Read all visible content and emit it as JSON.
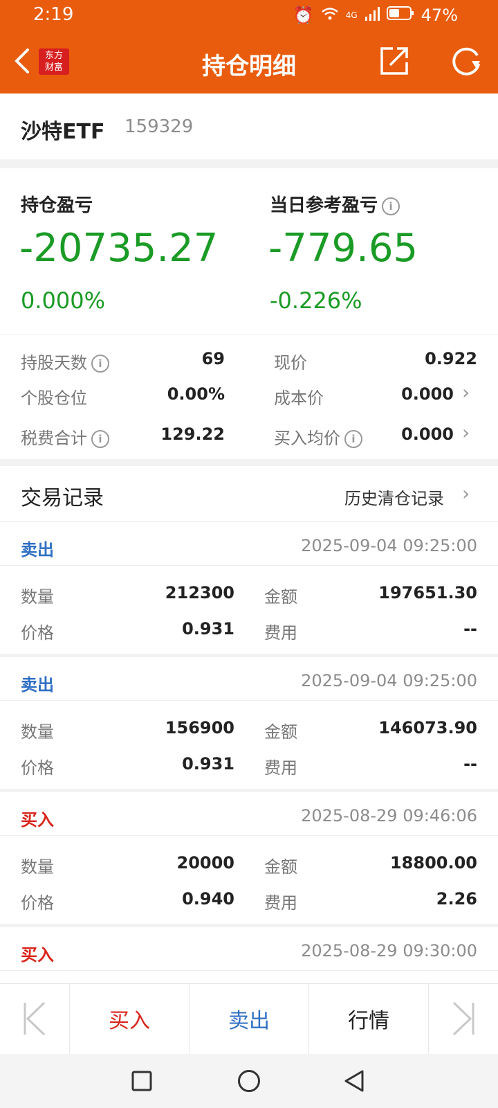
{
  "status": {
    "time": "2:19",
    "battery": "47%",
    "network": "4G"
  },
  "header": {
    "title": "持仓明细",
    "logo_line1": "东方",
    "logo_line2": "财富"
  },
  "stock": {
    "name": "沙特ETF",
    "code": "159329"
  },
  "summary": {
    "holding_pl_label": "持仓盈亏",
    "holding_pl": "-20735.27",
    "holding_pl_pct": "0.000%",
    "day_pl_label": "当日参考盈亏",
    "day_pl": "-779.65",
    "day_pl_pct": "-0.226%",
    "stats": {
      "days_label": "持股天数",
      "days": "69",
      "price_label": "现价",
      "price": "0.922",
      "position_label": "个股仓位",
      "position": "0.00%",
      "cost_label": "成本价",
      "cost": "0.000",
      "tax_label": "税费合计",
      "tax": "129.22",
      "avg_label": "买入均价",
      "avg": "0.000"
    }
  },
  "trades": {
    "title": "交易记录",
    "history_link": "历史清仓记录",
    "qty_label": "数量",
    "amount_label": "金额",
    "price_label": "价格",
    "fee_label": "费用",
    "records": [
      {
        "type": "卖出",
        "time": "2025-09-04 09:25:00",
        "qty": "212300",
        "amount": "197651.30",
        "price": "0.931",
        "fee": "--"
      },
      {
        "type": "卖出",
        "time": "2025-09-04 09:25:00",
        "qty": "156900",
        "amount": "146073.90",
        "price": "0.931",
        "fee": "--"
      },
      {
        "type": "买入",
        "time": "2025-08-29 09:46:06",
        "qty": "20000",
        "amount": "18800.00",
        "price": "0.940",
        "fee": "2.26"
      },
      {
        "type": "买入",
        "time": "2025-08-29 09:30:00"
      }
    ]
  },
  "bottom": {
    "buy": "买入",
    "sell": "卖出",
    "quote": "行情"
  },
  "colors": {
    "brand": "#e95c0d",
    "loss": "#1a9b25",
    "sell": "#2f6fc4",
    "buy": "#d9261c"
  }
}
